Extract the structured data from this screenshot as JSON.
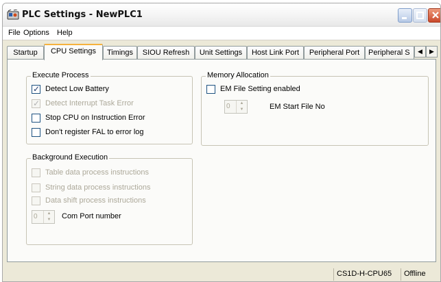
{
  "window": {
    "title": "PLC Settings - NewPLC1"
  },
  "menu": [
    "File",
    "Options",
    "Help"
  ],
  "tabs": [
    {
      "label": "Startup",
      "active": false
    },
    {
      "label": "CPU Settings",
      "active": true
    },
    {
      "label": "Timings",
      "active": false
    },
    {
      "label": "SIOU Refresh",
      "active": false
    },
    {
      "label": "Unit Settings",
      "active": false
    },
    {
      "label": "Host Link Port",
      "active": false
    },
    {
      "label": "Peripheral Port",
      "active": false
    },
    {
      "label": "Peripheral S",
      "active": false
    }
  ],
  "execute_process": {
    "title": "Execute Process",
    "options": [
      {
        "label": "Detect Low Battery",
        "checked": true,
        "enabled": true
      },
      {
        "label": "Detect Interrupt Task Error",
        "checked": true,
        "enabled": false
      },
      {
        "label": "Stop CPU on Instruction Error",
        "checked": false,
        "enabled": true
      },
      {
        "label": "Don't register FAL to error log",
        "checked": false,
        "enabled": true
      }
    ]
  },
  "background_execution": {
    "title": "Background Execution",
    "options": [
      {
        "label": "Table data process instructions",
        "checked": false,
        "enabled": false
      },
      {
        "label": "String data process instructions",
        "checked": false,
        "enabled": false
      },
      {
        "label": "Data shift process instructions",
        "checked": false,
        "enabled": false
      }
    ],
    "com_port": {
      "value": "0",
      "label": "Com Port number"
    }
  },
  "memory_allocation": {
    "title": "Memory Allocation",
    "em_file": {
      "label": "EM File Setting enabled",
      "checked": false
    },
    "em_start": {
      "value": "0",
      "label": "EM Start File No"
    }
  },
  "status": {
    "model": "CS1D-H-CPU65",
    "connection": "Offline"
  },
  "icons": {
    "app": "plc-icon",
    "min": "minimize-icon",
    "max": "maximize-icon",
    "close": "close-icon",
    "tab_left": "chevron-left-icon",
    "tab_right": "chevron-right-icon"
  }
}
